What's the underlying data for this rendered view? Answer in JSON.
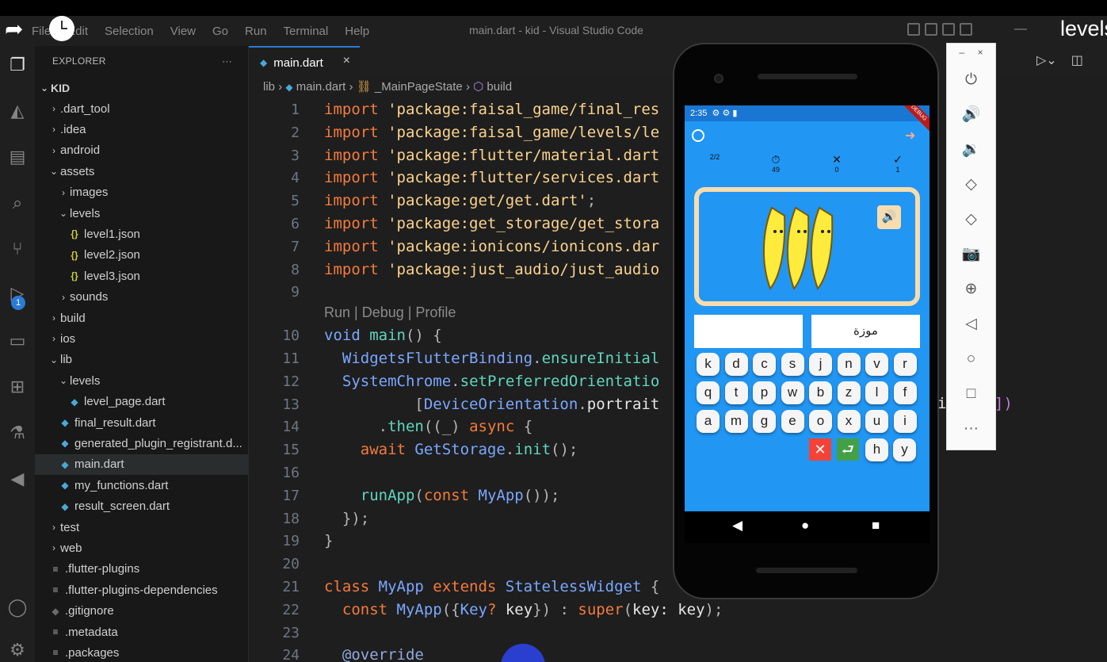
{
  "window": {
    "title": "main.dart - kid - Visual Studio Code",
    "menu": [
      "File",
      "Edit",
      "Selection",
      "View",
      "Go",
      "Run",
      "Terminal",
      "Help"
    ],
    "overlay_text": "levels"
  },
  "explorer": {
    "header": "EXPLORER",
    "more": "···",
    "root": "KID",
    "items": [
      {
        "label": ".dart_tool",
        "kind": "folder",
        "chevron": "›",
        "depth": 1
      },
      {
        "label": ".idea",
        "kind": "folder",
        "chevron": "›",
        "depth": 1
      },
      {
        "label": "android",
        "kind": "folder",
        "chevron": "›",
        "depth": 1
      },
      {
        "label": "assets",
        "kind": "folder-open",
        "chevron": "⌄",
        "depth": 1
      },
      {
        "label": "images",
        "kind": "folder",
        "chevron": "›",
        "depth": 2
      },
      {
        "label": "levels",
        "kind": "folder-open",
        "chevron": "⌄",
        "depth": 2
      },
      {
        "label": "level1.json",
        "kind": "json",
        "depth": 3
      },
      {
        "label": "level2.json",
        "kind": "json",
        "depth": 3
      },
      {
        "label": "level3.json",
        "kind": "json",
        "depth": 3
      },
      {
        "label": "sounds",
        "kind": "folder",
        "chevron": "›",
        "depth": 2
      },
      {
        "label": "build",
        "kind": "folder",
        "chevron": "›",
        "depth": 1
      },
      {
        "label": "ios",
        "kind": "folder",
        "chevron": "›",
        "depth": 1
      },
      {
        "label": "lib",
        "kind": "folder-open",
        "chevron": "⌄",
        "depth": 1
      },
      {
        "label": "levels",
        "kind": "folder-open",
        "chevron": "⌄",
        "depth": 2
      },
      {
        "label": "level_page.dart",
        "kind": "dart",
        "depth": 3
      },
      {
        "label": "final_result.dart",
        "kind": "dart",
        "depth": 2
      },
      {
        "label": "generated_plugin_registrant.d...",
        "kind": "dart",
        "depth": 2
      },
      {
        "label": "main.dart",
        "kind": "dart",
        "depth": 2,
        "selected": true
      },
      {
        "label": "my_functions.dart",
        "kind": "dart",
        "depth": 2
      },
      {
        "label": "result_screen.dart",
        "kind": "dart",
        "depth": 2
      },
      {
        "label": "test",
        "kind": "folder",
        "chevron": "›",
        "depth": 1
      },
      {
        "label": "web",
        "kind": "folder",
        "chevron": "›",
        "depth": 1
      },
      {
        "label": ".flutter-plugins",
        "kind": "list",
        "depth": 1
      },
      {
        "label": ".flutter-plugins-dependencies",
        "kind": "list",
        "depth": 1
      },
      {
        "label": ".gitignore",
        "kind": "git",
        "depth": 1
      },
      {
        "label": ".metadata",
        "kind": "list",
        "depth": 1
      },
      {
        "label": ".packages",
        "kind": "list",
        "depth": 1
      }
    ]
  },
  "activity": {
    "run_badge": "1"
  },
  "editor": {
    "tab_label": "main.dart",
    "tab_close": "×",
    "breadcrumb": {
      "folder": "lib",
      "file": "main.dart",
      "class": "_MainPageState",
      "method": "build"
    },
    "codelens": "Run | Debug | Profile",
    "fragments": {
      "right1": "i",
      "right2": "])"
    },
    "lines": [
      {
        "n": "1",
        "tokens": [
          [
            "kw",
            "import "
          ],
          [
            "str",
            "'package:faisal_game/final_res"
          ]
        ]
      },
      {
        "n": "2",
        "tokens": [
          [
            "kw",
            "import "
          ],
          [
            "str",
            "'package:faisal_game/levels/le"
          ]
        ]
      },
      {
        "n": "3",
        "tokens": [
          [
            "kw",
            "import "
          ],
          [
            "str",
            "'package:flutter/material.dart"
          ]
        ]
      },
      {
        "n": "4",
        "tokens": [
          [
            "kw",
            "import "
          ],
          [
            "str",
            "'package:flutter/services.dart"
          ]
        ]
      },
      {
        "n": "5",
        "tokens": [
          [
            "kw",
            "import "
          ],
          [
            "str",
            "'package:get/get.dart'"
          ],
          [
            "pu",
            ";"
          ]
        ]
      },
      {
        "n": "6",
        "tokens": [
          [
            "kw",
            "import "
          ],
          [
            "str",
            "'package:get_storage/get_stora"
          ]
        ]
      },
      {
        "n": "7",
        "tokens": [
          [
            "kw",
            "import "
          ],
          [
            "str",
            "'package:ionicons/ionicons.dar"
          ]
        ]
      },
      {
        "n": "8",
        "tokens": [
          [
            "kw",
            "import "
          ],
          [
            "str",
            "'package:just_audio/just_audio"
          ]
        ]
      },
      {
        "n": "9",
        "tokens": []
      },
      {
        "n": "10",
        "tokens": [
          [
            "ty",
            "void "
          ],
          [
            "fn",
            "main"
          ],
          [
            "pu",
            "() {"
          ]
        ]
      },
      {
        "n": "11",
        "tokens": [
          [
            "pl",
            "  "
          ],
          [
            "ty",
            "WidgetsFlutterBinding"
          ],
          [
            "pu",
            "."
          ],
          [
            "fn",
            "ensureInitial"
          ]
        ]
      },
      {
        "n": "12",
        "tokens": [
          [
            "pl",
            "  "
          ],
          [
            "ty",
            "SystemChrome"
          ],
          [
            "pu",
            "."
          ],
          [
            "fn",
            "setPreferredOrientatio"
          ]
        ]
      },
      {
        "n": "13",
        "tokens": [
          [
            "pl",
            "          "
          ],
          [
            "pu",
            "["
          ],
          [
            "ty",
            "DeviceOrientation"
          ],
          [
            "pu",
            "."
          ],
          [
            "pl",
            "portrait"
          ]
        ]
      },
      {
        "n": "14",
        "tokens": [
          [
            "pl",
            "      "
          ],
          [
            "pu",
            "."
          ],
          [
            "fn",
            "then"
          ],
          [
            "pu",
            "((_) "
          ],
          [
            "kw",
            "async "
          ],
          [
            "pu",
            "{"
          ]
        ]
      },
      {
        "n": "15",
        "tokens": [
          [
            "pl",
            "    "
          ],
          [
            "kw",
            "await "
          ],
          [
            "ty",
            "GetStorage"
          ],
          [
            "pu",
            "."
          ],
          [
            "fn",
            "init"
          ],
          [
            "pu",
            "();"
          ]
        ]
      },
      {
        "n": "16",
        "tokens": []
      },
      {
        "n": "17",
        "tokens": [
          [
            "pl",
            "    "
          ],
          [
            "fn",
            "runApp"
          ],
          [
            "pu",
            "("
          ],
          [
            "kw",
            "const "
          ],
          [
            "ty",
            "MyApp"
          ],
          [
            "pu",
            "());"
          ]
        ]
      },
      {
        "n": "18",
        "tokens": [
          [
            "pl",
            "  "
          ],
          [
            "pu",
            "});"
          ]
        ]
      },
      {
        "n": "19",
        "tokens": [
          [
            "pu",
            "}"
          ]
        ]
      },
      {
        "n": "20",
        "tokens": []
      },
      {
        "n": "21",
        "tokens": [
          [
            "kw",
            "class "
          ],
          [
            "ty",
            "MyApp "
          ],
          [
            "kw",
            "extends "
          ],
          [
            "ty",
            "StatelessWidget "
          ],
          [
            "pu",
            "{"
          ]
        ]
      },
      {
        "n": "22",
        "tokens": [
          [
            "pl",
            "  "
          ],
          [
            "kw",
            "const "
          ],
          [
            "ty",
            "MyApp"
          ],
          [
            "pu",
            "({"
          ],
          [
            "ty",
            "Key"
          ],
          [
            "kw",
            "? "
          ],
          [
            "pl",
            "key"
          ],
          [
            "pu",
            "}) : "
          ],
          [
            "kw",
            "super"
          ],
          [
            "pu",
            "("
          ],
          [
            "pl",
            "key: key"
          ],
          [
            "pu",
            ");"
          ]
        ]
      },
      {
        "n": "23",
        "tokens": []
      },
      {
        "n": "24",
        "tokens": [
          [
            "pl",
            "  "
          ],
          [
            "an",
            "@override"
          ]
        ]
      }
    ]
  },
  "phone": {
    "status_time": "2:35",
    "debug_label": "DEBUG",
    "stats": [
      {
        "icon": "",
        "value": "2/2"
      },
      {
        "icon": "⏱",
        "value": "49"
      },
      {
        "icon": "✕",
        "value": "0"
      },
      {
        "icon": "✓",
        "value": "1"
      }
    ],
    "answer_left": "",
    "answer_right": "موزة",
    "keys_row1": [
      "k",
      "d",
      "c",
      "s",
      "j",
      "n",
      "v",
      "r"
    ],
    "keys_row2": [
      "q",
      "t",
      "p",
      "w",
      "b",
      "z",
      "l",
      "f"
    ],
    "keys_row3": [
      "a",
      "m",
      "g",
      "e",
      "o",
      "x",
      "u",
      "i"
    ],
    "keys_row4": [
      "h",
      "y"
    ],
    "delete_color": "#f44336",
    "submit_color": "#43a047",
    "card_color": "#f8dcae",
    "screen_color": "#2196f3"
  }
}
